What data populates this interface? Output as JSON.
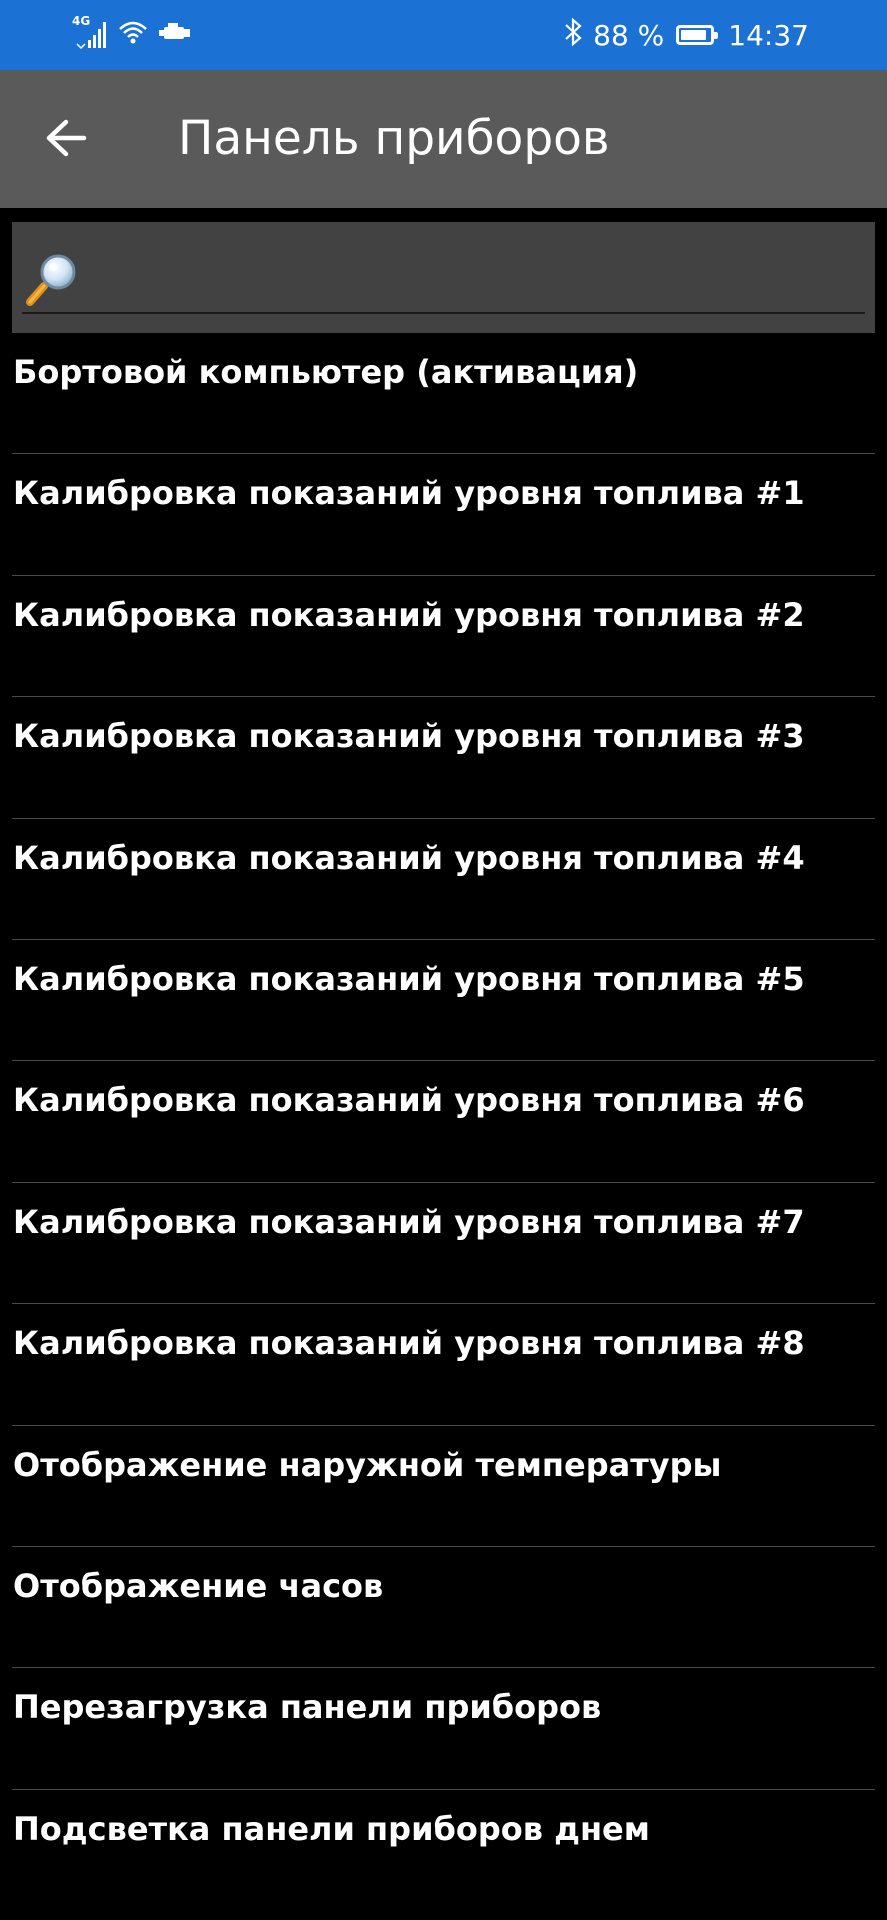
{
  "status_bar": {
    "network_type": "4G",
    "battery_text": "88 %",
    "battery_level": 0.88,
    "time": "14:37",
    "icons": [
      "signal-icon",
      "wifi-icon",
      "car-icon",
      "bluetooth-icon",
      "battery-icon"
    ]
  },
  "app_bar": {
    "back_icon": "arrow-left-icon",
    "title": "Панель приборов"
  },
  "search": {
    "icon": "magnifier-icon",
    "placeholder": "",
    "value": ""
  },
  "menu": {
    "items": [
      {
        "label": "Бортовой компьютер (активация)"
      },
      {
        "label": "Калибровка показаний уровня топлива #1"
      },
      {
        "label": "Калибровка показаний уровня топлива #2"
      },
      {
        "label": "Калибровка показаний уровня топлива #3"
      },
      {
        "label": "Калибровка показаний уровня топлива #4"
      },
      {
        "label": "Калибровка показаний уровня топлива #5"
      },
      {
        "label": "Калибровка показаний уровня топлива #6"
      },
      {
        "label": "Калибровка показаний уровня топлива #7"
      },
      {
        "label": "Калибровка показаний уровня топлива #8"
      },
      {
        "label": "Отображение наружной температуры"
      },
      {
        "label": "Отображение часов"
      },
      {
        "label": "Перезагрузка панели приборов"
      },
      {
        "label": "Подсветка панели приборов днем"
      }
    ]
  },
  "colors": {
    "status_bar_bg": "#1c72d4",
    "app_bar_bg": "#5a5a5a",
    "search_bg": "#424242",
    "list_bg": "#000000",
    "divider": "#4a4a4a",
    "text": "#ffffff"
  }
}
